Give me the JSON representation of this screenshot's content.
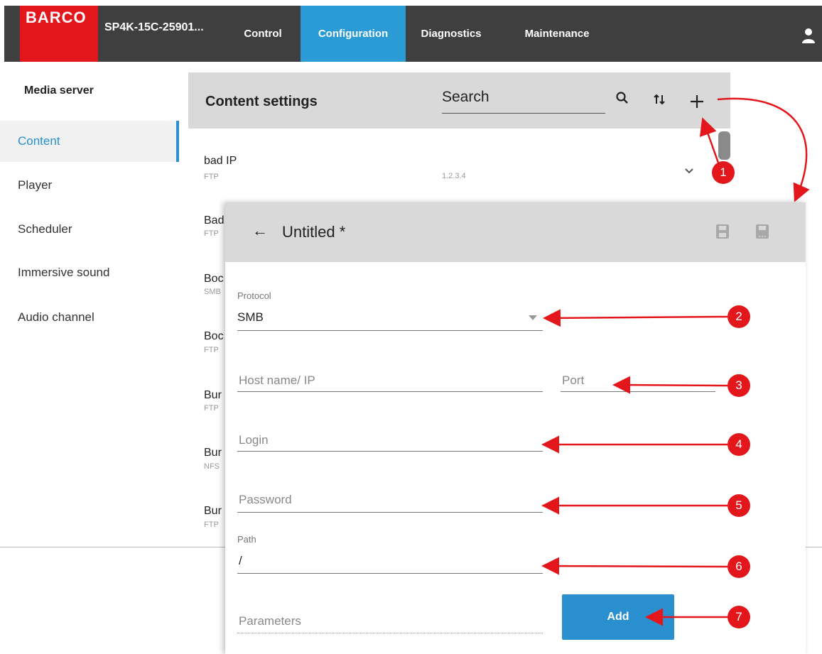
{
  "topbar": {
    "logo": "BARCO",
    "device_name": "SP4K-15C-25901...",
    "tabs": [
      "Control",
      "Configuration",
      "Diagnostics",
      "Maintenance"
    ],
    "active_tab": "Configuration",
    "brand_color": "#e3171b",
    "accent_color": "#2a9bd5"
  },
  "sidebar": {
    "heading": "Media server",
    "items": [
      {
        "label": "Content",
        "active": true
      },
      {
        "label": "Player",
        "active": false
      },
      {
        "label": "Scheduler",
        "active": false
      },
      {
        "label": "Immersive sound",
        "active": false
      },
      {
        "label": "Audio channel",
        "active": false
      }
    ]
  },
  "content_settings": {
    "title": "Content settings",
    "search_placeholder": "Search",
    "icons": [
      "search-icon",
      "sort-icon",
      "add-icon"
    ],
    "items": [
      {
        "title": "bad IP",
        "protocol": "FTP",
        "address": "1.2.3.4"
      },
      {
        "title": "Bad",
        "protocol": "FTP"
      },
      {
        "title": "Boc",
        "protocol": "SMB"
      },
      {
        "title": "Boc",
        "protocol": "FTP"
      },
      {
        "title": "Bur",
        "protocol": "FTP"
      },
      {
        "title": "Bur",
        "protocol": "NFS"
      },
      {
        "title": "Bur",
        "protocol": "FTP"
      }
    ]
  },
  "modal": {
    "back_arrow": "←",
    "title": "Untitled *",
    "protocol": {
      "label": "Protocol",
      "value": "SMB"
    },
    "host": {
      "placeholder": "Host name/ IP"
    },
    "port": {
      "placeholder": "Port"
    },
    "login": {
      "placeholder": "Login"
    },
    "password": {
      "placeholder": "Password"
    },
    "path": {
      "label": "Path",
      "value": "/"
    },
    "parameters": {
      "placeholder": "Parameters"
    },
    "add_label": "Add"
  },
  "callouts": [
    "1",
    "2",
    "3",
    "4",
    "5",
    "6",
    "7"
  ]
}
